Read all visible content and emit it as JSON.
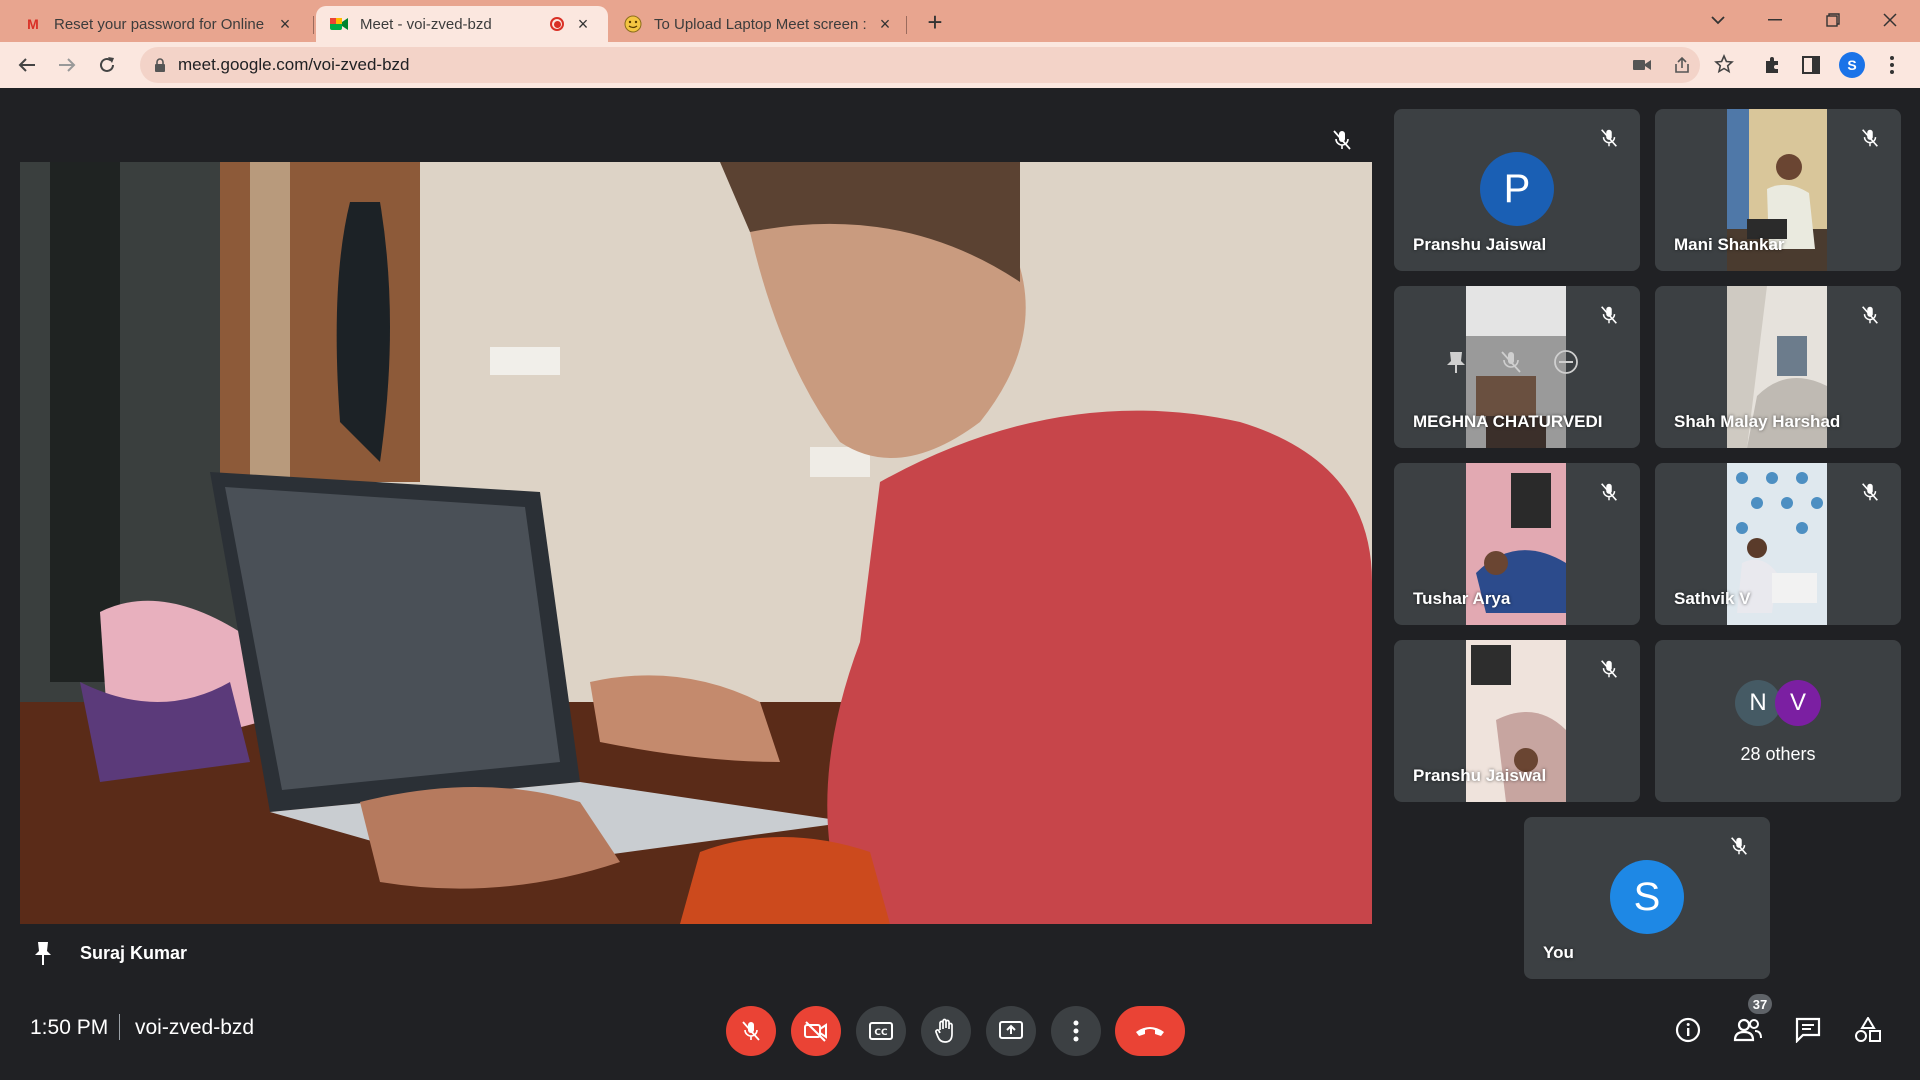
{
  "browser": {
    "tabs": [
      {
        "favicon": "gmail-icon",
        "title": "Reset your password for Online D",
        "active": false
      },
      {
        "favicon": "google-meet-icon",
        "title": "Meet - voi-zved-bzd",
        "active": true,
        "recording": true
      },
      {
        "favicon": "emoji-icon",
        "title": "To Upload Laptop Meet screen :",
        "active": false
      }
    ],
    "url": "meet.google.com/voi-zved-bzd",
    "profile_initial": "S"
  },
  "meeting": {
    "main_speaker": "Suraj Kumar",
    "time": "1:50 PM",
    "code": "voi-zved-bzd",
    "participant_count": "37",
    "tiles": [
      {
        "name": "Pranshu Jaiswal",
        "avatar": "P",
        "avatar_color": "#1a5fb4"
      },
      {
        "name": "Mani Shankar"
      },
      {
        "name": "MEGHNA CHATURVEDI"
      },
      {
        "name": "Shah Malay Harshad"
      },
      {
        "name": "Tushar Arya"
      },
      {
        "name": "Sathvik V"
      },
      {
        "name": "Pranshu Jaiswal"
      },
      {
        "others_label": "28 others",
        "avatars": [
          "N",
          "V"
        ]
      }
    ],
    "self_tile": {
      "name": "You",
      "avatar": "S",
      "avatar_color": "#1e88e5"
    }
  },
  "colors": {
    "tabstrip": "#e8a58f",
    "toolbar": "#fbe7df",
    "meet_bg": "#202124",
    "tile_bg": "#3c4043",
    "danger": "#ea4335"
  }
}
